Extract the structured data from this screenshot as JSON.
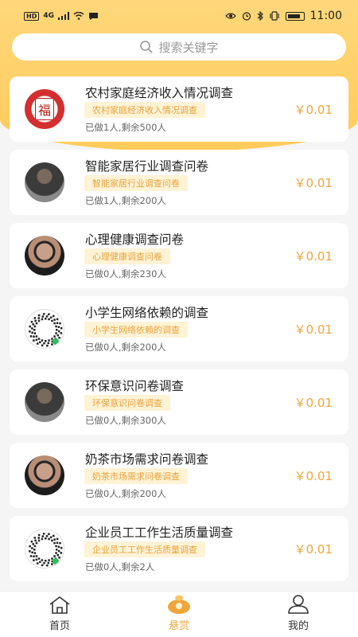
{
  "status_bar": {
    "network": "4G",
    "hd": "HD",
    "time": "11:00"
  },
  "search": {
    "placeholder": "搜索关键字"
  },
  "surveys": [
    {
      "title": "农村家庭经济收入情况调查",
      "tag": "农村家庭经济收入情况调查",
      "meta": "已做1人,剩余500人",
      "price": "￥0.01",
      "avatar": "fu",
      "avatar_text": "福"
    },
    {
      "title": "智能家居行业调查问卷",
      "tag": "智能家居行业调查问卷",
      "meta": "已做1人,剩余200人",
      "price": "￥0.01",
      "avatar": "man"
    },
    {
      "title": "心理健康调查问卷",
      "tag": "心理健康调查问卷",
      "meta": "已做0人,剩余230人",
      "price": "￥0.01",
      "avatar": "glasses"
    },
    {
      "title": "小学生网络依赖的调查",
      "tag": "小学生网络依赖的调查",
      "meta": "已做0人,剩余200人",
      "price": "￥0.01",
      "avatar": "qr"
    },
    {
      "title": "环保意识问卷调查",
      "tag": "环保意识问卷调查",
      "meta": "已做0人,剩余300人",
      "price": "￥0.01",
      "avatar": "man"
    },
    {
      "title": "奶茶市场需求问卷调查",
      "tag": "奶茶市场需求问卷调查",
      "meta": "已做0人,剩余200人",
      "price": "￥0.01",
      "avatar": "glasses"
    },
    {
      "title": "企业员工工作生活质量调查",
      "tag": "企业员工工作生活质量调查",
      "meta": "已做0人,剩余2人",
      "price": "￥0.01",
      "avatar": "qr"
    }
  ],
  "tabbar": {
    "home": "首页",
    "reward": "悬赏",
    "mine": "我的"
  },
  "colors": {
    "accent": "#f0a53a",
    "header": "#ffcb5a"
  }
}
